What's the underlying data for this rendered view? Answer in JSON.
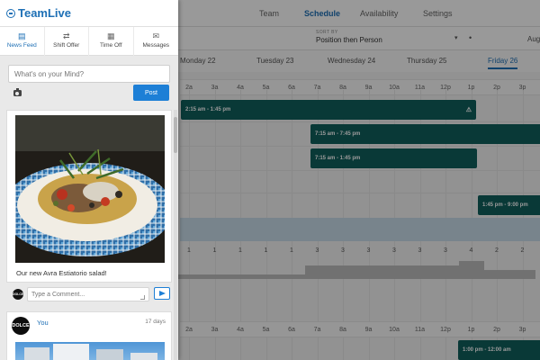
{
  "app": {
    "nav": [
      "Team",
      "Schedule",
      "Availability",
      "Settings"
    ],
    "active_nav": "Schedule",
    "sort": {
      "caption": "SORT BY",
      "value": "Position then Person"
    },
    "month_partial": "Aug",
    "days": [
      "Monday 22",
      "Tuesday 23",
      "Wednesday 24",
      "Thursday 25",
      "Friday 26"
    ],
    "active_day": "Friday 26",
    "hours": [
      "2a",
      "3a",
      "4a",
      "5a",
      "6a",
      "7a",
      "8a",
      "9a",
      "10a",
      "11a",
      "12p",
      "1p",
      "2p",
      "3p"
    ],
    "shifts": [
      {
        "label": "2:15 am - 1:45 pm",
        "warning": "⚠"
      },
      {
        "label": "7:15 am - 7:45 pm"
      },
      {
        "label": "7:15 am - 1:45 pm"
      },
      {
        "label": "1:45 pm - 9:00 pm"
      },
      {
        "label": "1:00 pm - 12:00 am"
      }
    ],
    "counts": [
      1,
      1,
      1,
      1,
      1,
      3,
      3,
      3,
      3,
      3,
      3,
      4,
      2,
      2
    ],
    "colors": {
      "brand": "#1d6fb5",
      "shift": "#0f5f5d",
      "post_button": "#1d7fd6"
    }
  },
  "panel": {
    "brand": "TeamLive",
    "tabs": [
      {
        "label": "News Feed",
        "icon": "newspaper-icon"
      },
      {
        "label": "Shift Offer",
        "icon": "swap-icon"
      },
      {
        "label": "Time Off",
        "icon": "calendar-icon"
      },
      {
        "label": "Messages",
        "icon": "envelope-icon"
      }
    ],
    "active_tab": "News Feed",
    "composer": {
      "placeholder": "What's on your Mind?",
      "post_label": "Post"
    },
    "feed": {
      "post1": {
        "caption": "Our new Avra Estiatorio salad!",
        "comment_placeholder": "Type a Comment...",
        "avatar_text": "DOLCE"
      },
      "post2": {
        "author": "You",
        "time": "17 days",
        "avatar_text": "DOLCE"
      }
    }
  }
}
